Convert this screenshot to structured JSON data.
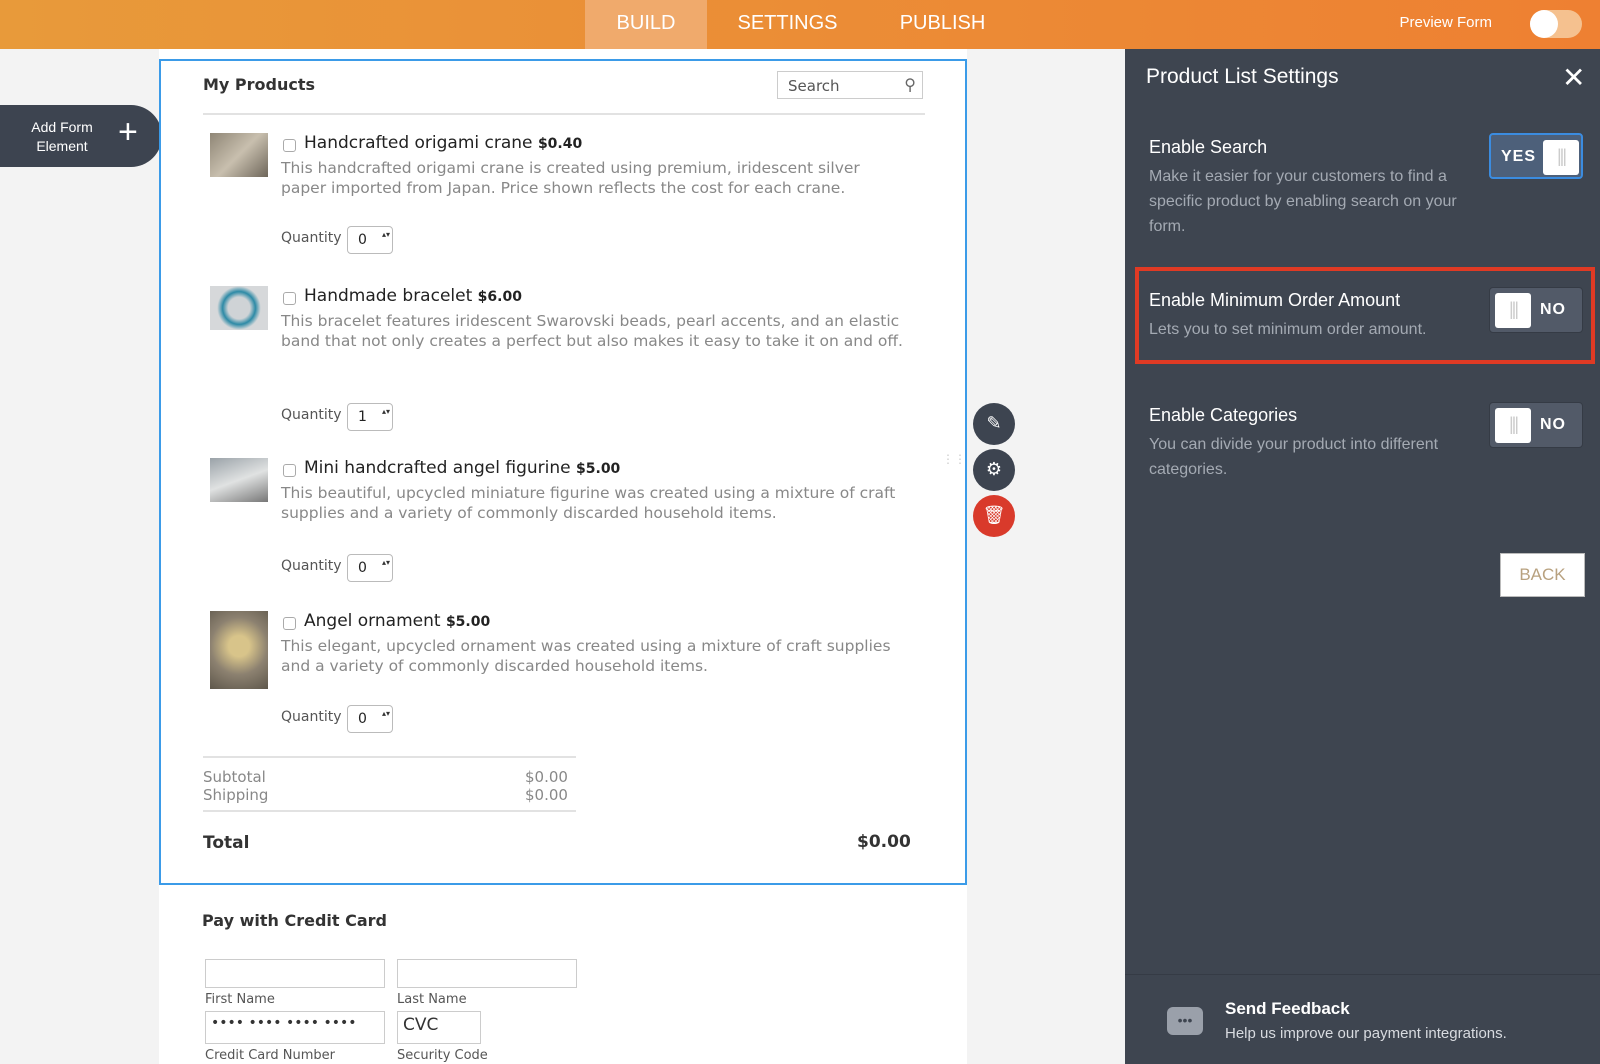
{
  "topbar": {
    "tabs": [
      "BUILD",
      "SETTINGS",
      "PUBLISH"
    ],
    "preview_label": "Preview Form"
  },
  "add_element": {
    "label": "Add Form Element",
    "icon": "plus-icon"
  },
  "products": {
    "title": "My Products",
    "search_placeholder": "Search",
    "quantity_label": "Quantity",
    "items": [
      {
        "name": "Handcrafted origami crane",
        "price": "$0.40",
        "desc": "This handcrafted origami crane is created using premium, iridescent silver paper imported from Japan. Price shown reflects the cost for each crane.",
        "qty": "0"
      },
      {
        "name": "Handmade bracelet",
        "price": "$6.00",
        "desc": "This bracelet features iridescent Swarovski beads, pearl accents, and an elastic band that not only creates a perfect but also makes it easy to take it on and off.",
        "qty": "1"
      },
      {
        "name": "Mini handcrafted angel figurine",
        "price": "$5.00",
        "desc": "This beautiful, upcycled miniature figurine was created using a mixture of craft supplies and a variety of commonly discarded household items.",
        "qty": "0"
      },
      {
        "name": "Angel ornament",
        "price": "$5.00",
        "desc": "This elegant, upcycled ornament was created using a mixture of craft supplies and a variety of commonly discarded household items.",
        "qty": "0"
      }
    ],
    "subtotal_label": "Subtotal",
    "subtotal": "$0.00",
    "shipping_label": "Shipping",
    "shipping": "$0.00",
    "total_label": "Total",
    "total": "$0.00"
  },
  "payment": {
    "title": "Pay with Credit Card",
    "first_name": "First Name",
    "last_name": "Last Name",
    "card_number": "Credit Card Number",
    "card_value": "•••• •••• •••• ••••",
    "security_code": "Security Code",
    "cvc_placeholder": "CVC"
  },
  "panel": {
    "title": "Product List Settings",
    "settings": [
      {
        "label": "Enable Search",
        "desc": "Make it easier for your customers to find a specific product by enabling search on your form.",
        "state": "YES"
      },
      {
        "label": "Enable Minimum Order Amount",
        "desc": "Lets you to set minimum order amount.",
        "state": "NO"
      },
      {
        "label": "Enable Categories",
        "desc": "You can divide your product into different categories.",
        "state": "NO"
      }
    ],
    "back": "BACK",
    "feedback_title": "Send Feedback",
    "feedback_desc": "Help us improve our payment integrations."
  },
  "colors": {
    "accent": "#ee8032",
    "panel": "#3e4550",
    "highlight": "#e03a24",
    "selection": "#3b9be8"
  }
}
